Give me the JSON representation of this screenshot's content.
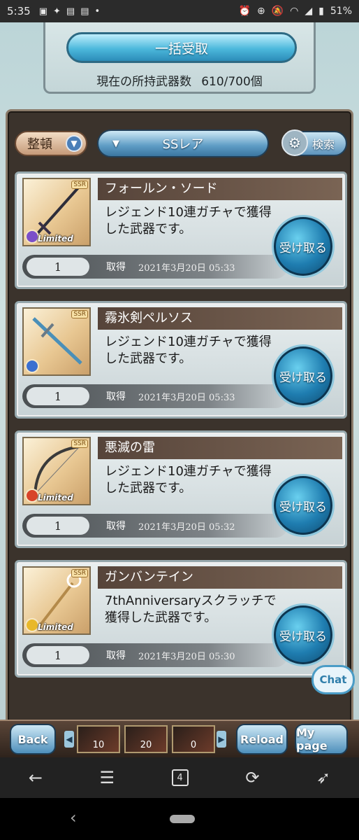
{
  "status_bar": {
    "time": "5:35",
    "battery": "51%",
    "left_icons": [
      "image-icon",
      "twitter-icon",
      "news-icon",
      "news-icon",
      "dot-icon"
    ],
    "right_icons": [
      "alarm-icon",
      "data-saver-icon",
      "mute-icon",
      "wifi-icon",
      "signal-icon",
      "battery-icon"
    ]
  },
  "top_panel": {
    "claim_all_label": "一括受取",
    "weapon_count_label": "現在の所持武器数",
    "weapon_count_value": "610/700個"
  },
  "toolbar": {
    "sort_label": "整頓",
    "filter_label": "SSレア",
    "search_label": "検索"
  },
  "cards": [
    {
      "name": "フォールン・ソード",
      "description": "レジェンド10連ガチャで獲得した武器です。",
      "quantity": "1",
      "acquired_label": "取得",
      "date": "2021年3月20日 05:33",
      "rarity": "SSR",
      "limited": "Limited",
      "element_color": "#7b4fc9",
      "receive_label": "受け取る"
    },
    {
      "name": "霧氷剣ペルソス",
      "description": "レジェンド10連ガチャで獲得した武器です。",
      "quantity": "1",
      "acquired_label": "取得",
      "date": "2021年3月20日 05:33",
      "rarity": "SSR",
      "limited": "",
      "element_color": "#3b6fd0",
      "receive_label": "受け取る"
    },
    {
      "name": "悪滅の雷",
      "description": "レジェンド10連ガチャで獲得した武器です。",
      "quantity": "1",
      "acquired_label": "取得",
      "date": "2021年3月20日 05:32",
      "rarity": "SSR",
      "limited": "Limited",
      "element_color": "#d8442a",
      "receive_label": "受け取る"
    },
    {
      "name": "ガンバンテイン",
      "description": "7thAnniversaryスクラッチで獲得した武器です。",
      "quantity": "1",
      "acquired_label": "取得",
      "date": "2021年3月20日 05:30",
      "rarity": "SSR",
      "limited": "Limited",
      "element_color": "#e8b82a",
      "receive_label": "受け取る"
    }
  ],
  "chat_label": "Chat",
  "game_nav": {
    "back_label": "Back",
    "reload_label": "Reload",
    "mypage_label": "My page",
    "ability_counts": [
      "10",
      "20",
      "0"
    ]
  },
  "browser_bar": {
    "tab_count": "4"
  }
}
